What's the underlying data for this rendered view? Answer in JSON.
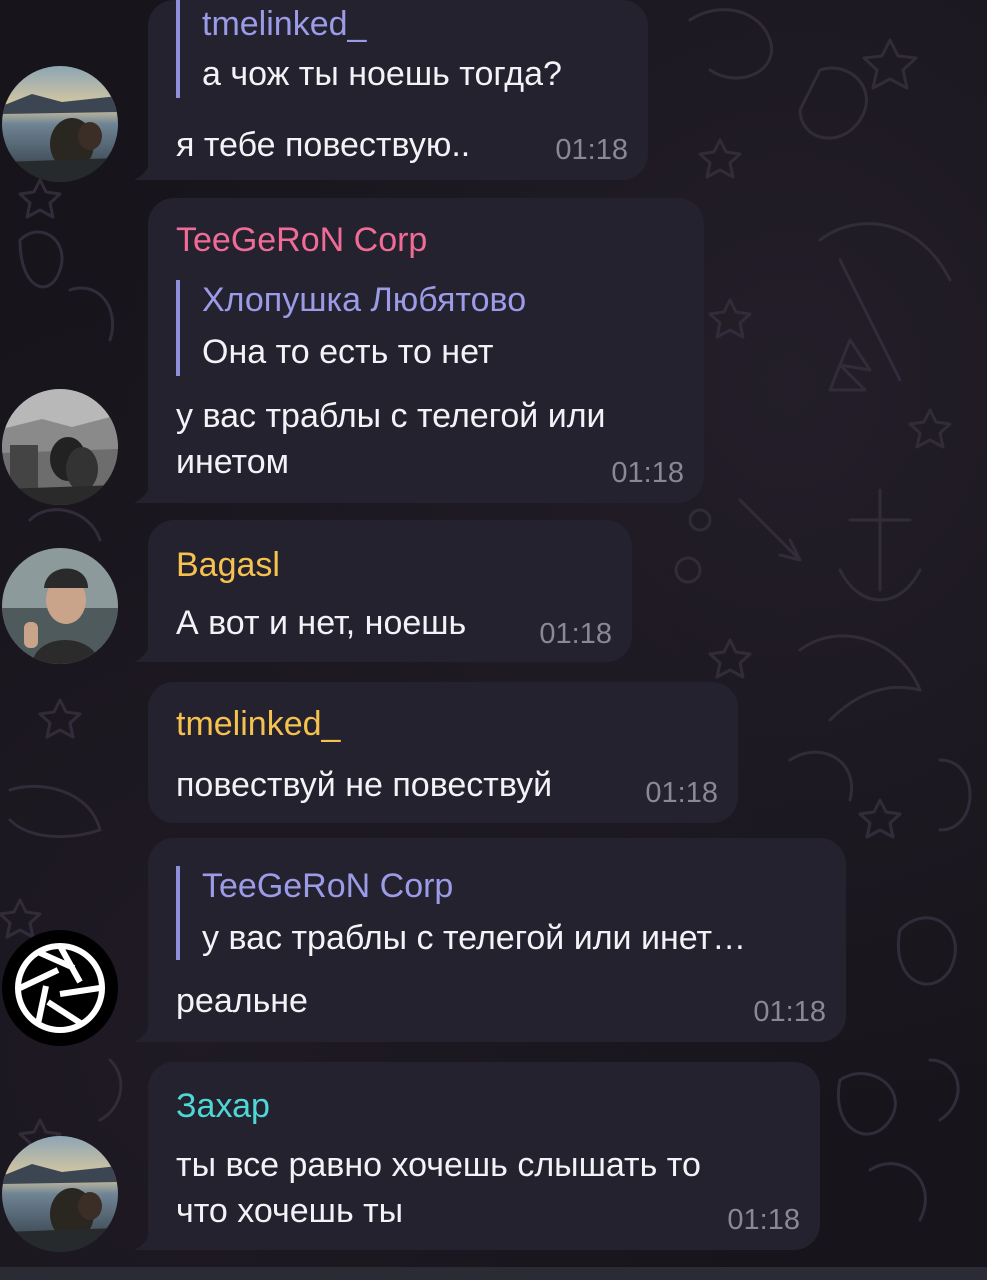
{
  "colors": {
    "bubble_bg": "#24222e",
    "chat_bg": "#17141b",
    "reply_bar": "#8f8fdc",
    "reply_name": "#9b9be8",
    "message_text": "#f3f2f7",
    "time_text": "#8a8797"
  },
  "messages": [
    {
      "sender": "",
      "reply": {
        "name": "tmelinked_",
        "text": "а чож ты ноешь тогда?"
      },
      "text": "я тебе повествую..",
      "time": "01:18",
      "avatar": "sunset-couple-photo-avatar"
    },
    {
      "sender": "TeeGeRoN Corp",
      "sender_color": "#f06c96",
      "reply": {
        "name": "Хлопушка Любятово",
        "text": "Она то есть то нет"
      },
      "text": "у вас траблы с телегой или\nинетом",
      "time": "01:18",
      "avatar": "black-white-couple-photo-avatar"
    },
    {
      "sender": "Bagasl",
      "sender_color": "#f5c14f",
      "text": "А вот и нет, ноешь",
      "time": "01:18",
      "avatar": "man-in-beanie-photo-avatar"
    },
    {
      "sender": "tmelinked_",
      "sender_color": "#f5c14f",
      "text": "повествуй не повествуй",
      "time": "01:18"
    },
    {
      "sender": "",
      "reply": {
        "name": "TeeGeRoN Corp",
        "text": "у вас траблы с телегой или инет…"
      },
      "text": "реальне",
      "time": "01:18",
      "avatar": "camera-shutter-logo-avatar"
    },
    {
      "sender": "Захар",
      "sender_color": "#4fd6d6",
      "text": "ты все равно хочешь слышать то\nчто хочешь ты",
      "time": "01:18",
      "avatar": "sunset-couple-photo-avatar"
    }
  ]
}
